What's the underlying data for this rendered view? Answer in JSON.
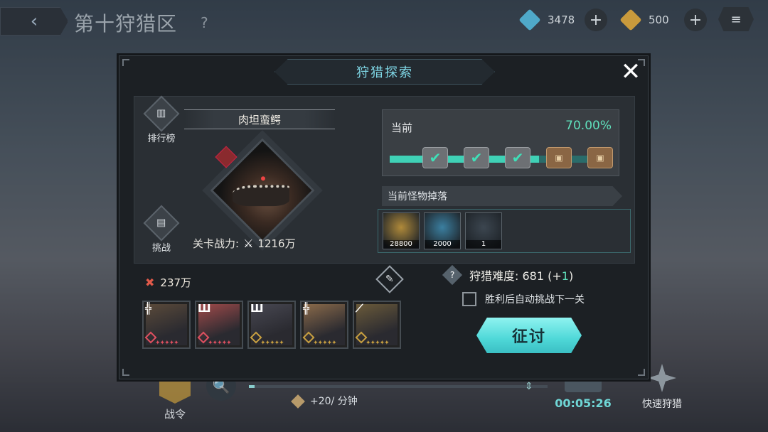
{
  "header": {
    "back_icon": "back-arrow-icon",
    "zone_title": "第十狩猎区",
    "help_icon": "?",
    "resources": [
      {
        "icon": "blue-crystal-icon",
        "value": "3478",
        "color": "#4fa9c9"
      },
      {
        "icon": "gold-crystal-icon",
        "value": "500",
        "color": "#c99a3c"
      }
    ],
    "plus_glyph": "+",
    "menu_icon": "≡"
  },
  "bottom_hud": {
    "battle_pass_label": "战令",
    "zoom_icon": "🔍",
    "rate_text": "+20/ 分钟",
    "timer": "00:05:26",
    "quick_hunt_label": "快速狩猎"
  },
  "modal": {
    "title": "狩猎探索",
    "close_glyph": "✕",
    "rank_label": "排行榜",
    "rank_icon": "▥",
    "challenge_label": "挑战",
    "challenge_icon": "▤",
    "boss_name": "肉坦蛮鳄",
    "stage_power_label": "关卡战力:",
    "stage_power_value": "1216万",
    "progress": {
      "label": "当前",
      "percent": "70.00%",
      "fraction": 0.7,
      "stages": [
        {
          "type": "cleared",
          "glyph": "✔"
        },
        {
          "type": "cleared",
          "glyph": "✔"
        },
        {
          "type": "cleared",
          "glyph": "✔"
        },
        {
          "type": "chest",
          "glyph": "▣"
        },
        {
          "type": "chest",
          "glyph": "▣"
        }
      ]
    },
    "drops_title": "当前怪物掉落",
    "drops": [
      {
        "icon": "gold-badge-icon",
        "qty": "28800",
        "color": "#b08a3a"
      },
      {
        "icon": "blue-crystal-shard-icon",
        "qty": "2000",
        "color": "#3b7fa0"
      },
      {
        "icon": "bullet-icon",
        "qty": "1",
        "color": "#3c4650"
      }
    ],
    "team_power": "237万",
    "team_power_icon": "✖",
    "edit_icon": "✎",
    "difficulty_label": "狩猎难度:",
    "difficulty_value": "681",
    "difficulty_delta_prefix": "(+",
    "difficulty_delta": "1",
    "difficulty_delta_suffix": ")",
    "auto_next_label": "胜利后自动挑战下一关",
    "auto_next_checked": false,
    "attack_label": "征讨",
    "team": [
      {
        "cls": "╬",
        "color": "#5a4a3a",
        "accent": "#e05060",
        "stars": "✦✦✦✦✦"
      },
      {
        "cls": "Ш",
        "color": "#a04a4a",
        "accent": "#e05060",
        "stars": "✦✦✦✦✦"
      },
      {
        "cls": "Ш",
        "color": "#484852",
        "accent": "#c8a040",
        "stars": "✦✦✦✦✦"
      },
      {
        "cls": "╬",
        "color": "#8a6a4a",
        "accent": "#c8a040",
        "stars": "✦✦✦✦✦"
      },
      {
        "cls": "⟋",
        "color": "#6a5a3a",
        "accent": "#c8a040",
        "stars": "✦✦✦✦✦"
      }
    ]
  }
}
